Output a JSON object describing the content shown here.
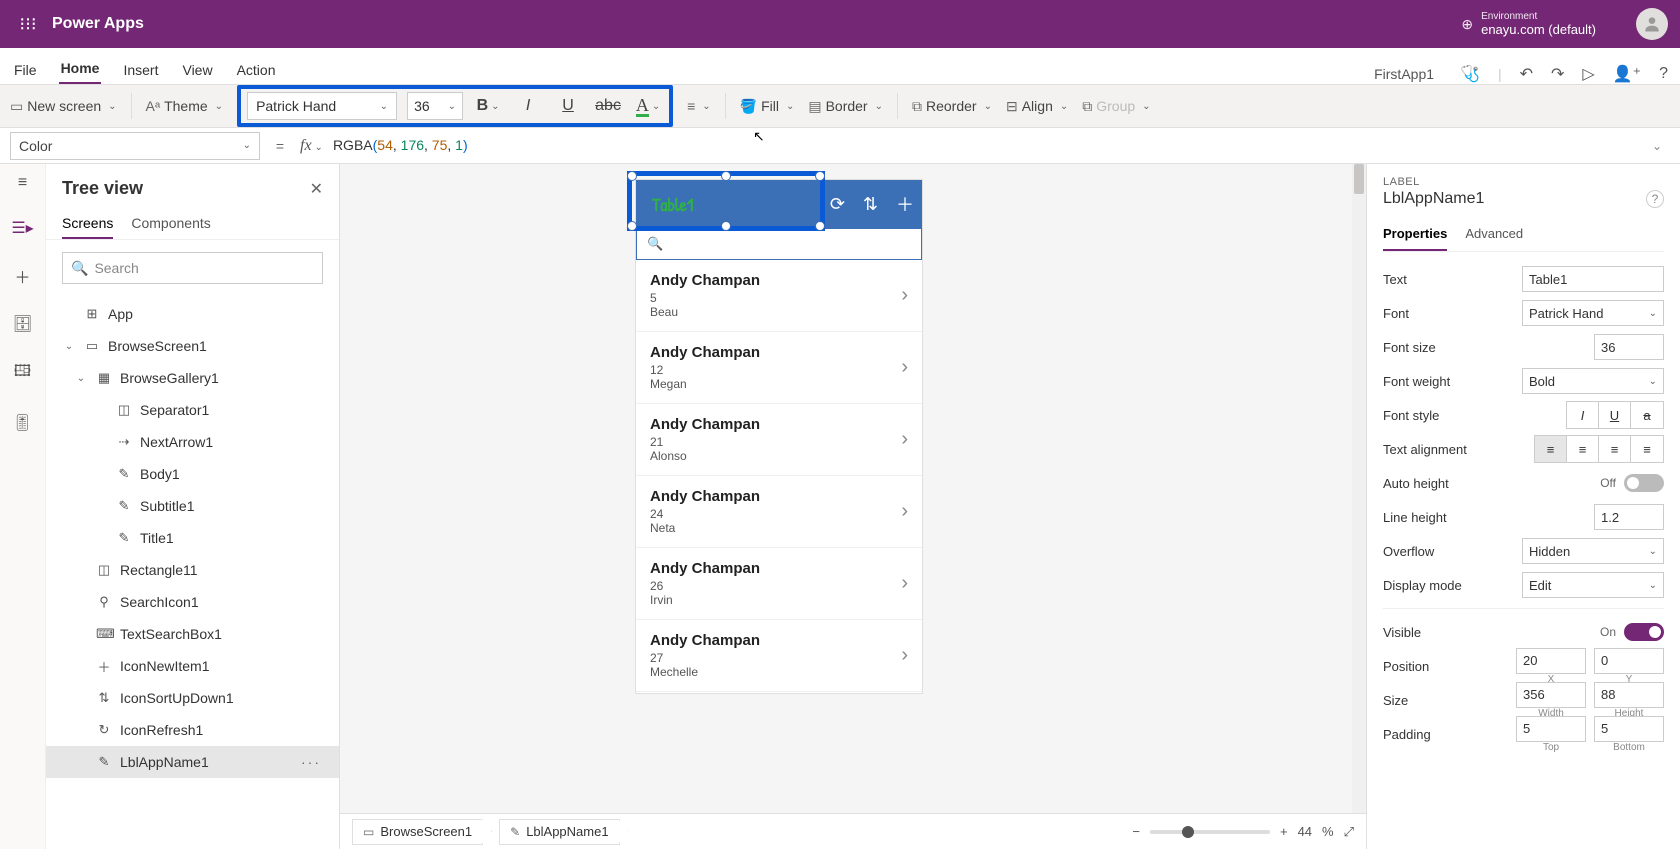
{
  "header": {
    "brand": "Power Apps",
    "env_label": "Environment",
    "env_name": "enayu.com (default)"
  },
  "menubar": {
    "items": [
      "File",
      "Home",
      "Insert",
      "View",
      "Action"
    ],
    "active": "Home",
    "app_name": "FirstApp1"
  },
  "ribbon": {
    "new_screen": "New screen",
    "theme": "Theme",
    "font_name": "Patrick Hand",
    "font_size": "36",
    "fill": "Fill",
    "border": "Border",
    "reorder": "Reorder",
    "align": "Align",
    "group": "Group"
  },
  "formula": {
    "property": "Color",
    "fn": "RGBA",
    "args": [
      "54",
      "176",
      "75",
      "1"
    ]
  },
  "tree": {
    "title": "Tree view",
    "tabs": [
      "Screens",
      "Components"
    ],
    "active_tab": "Screens",
    "search_placeholder": "Search",
    "nodes": [
      {
        "label": "App",
        "icon": "⊞",
        "indent": 0,
        "exp": ""
      },
      {
        "label": "BrowseScreen1",
        "icon": "▭",
        "indent": 0,
        "exp": "⌄"
      },
      {
        "label": "BrowseGallery1",
        "icon": "▦",
        "indent": 1,
        "exp": "⌄"
      },
      {
        "label": "Separator1",
        "icon": "◫",
        "indent": 2,
        "exp": ""
      },
      {
        "label": "NextArrow1",
        "icon": "⇢",
        "indent": 2,
        "exp": ""
      },
      {
        "label": "Body1",
        "icon": "✎",
        "indent": 2,
        "exp": ""
      },
      {
        "label": "Subtitle1",
        "icon": "✎",
        "indent": 2,
        "exp": ""
      },
      {
        "label": "Title1",
        "icon": "✎",
        "indent": 2,
        "exp": ""
      },
      {
        "label": "Rectangle11",
        "icon": "◫",
        "indent": 1,
        "exp": ""
      },
      {
        "label": "SearchIcon1",
        "icon": "⚲",
        "indent": 1,
        "exp": ""
      },
      {
        "label": "TextSearchBox1",
        "icon": "⌨",
        "indent": 1,
        "exp": ""
      },
      {
        "label": "IconNewItem1",
        "icon": "＋",
        "indent": 1,
        "exp": ""
      },
      {
        "label": "IconSortUpDown1",
        "icon": "⇅",
        "indent": 1,
        "exp": ""
      },
      {
        "label": "IconRefresh1",
        "icon": "↻",
        "indent": 1,
        "exp": ""
      },
      {
        "label": "LblAppName1",
        "icon": "✎",
        "indent": 1,
        "exp": "",
        "selected": true,
        "dots": true
      }
    ]
  },
  "canvas": {
    "title_text": "Table1",
    "gallery": [
      {
        "t1": "Andy Champan",
        "t2": "5",
        "t3": "Beau"
      },
      {
        "t1": "Andy Champan",
        "t2": "12",
        "t3": "Megan"
      },
      {
        "t1": "Andy Champan",
        "t2": "21",
        "t3": "Alonso"
      },
      {
        "t1": "Andy Champan",
        "t2": "24",
        "t3": "Neta"
      },
      {
        "t1": "Andy Champan",
        "t2": "26",
        "t3": "Irvin"
      },
      {
        "t1": "Andy Champan",
        "t2": "27",
        "t3": "Mechelle"
      }
    ],
    "breadcrumb": [
      "BrowseScreen1",
      "LblAppName1"
    ],
    "zoom_pct": "44",
    "zoom_unit": "%"
  },
  "props": {
    "type_label": "LABEL",
    "name": "LblAppName1",
    "tabs": [
      "Properties",
      "Advanced"
    ],
    "active_tab": "Properties",
    "rows": {
      "text_lab": "Text",
      "text_val": "Table1",
      "font_lab": "Font",
      "font_val": "Patrick Hand",
      "size_lab": "Font size",
      "size_val": "36",
      "weight_lab": "Font weight",
      "weight_val": "Bold",
      "style_lab": "Font style",
      "align_lab": "Text alignment",
      "autoh_lab": "Auto height",
      "autoh_val": "Off",
      "lineh_lab": "Line height",
      "lineh_val": "1.2",
      "overflow_lab": "Overflow",
      "overflow_val": "Hidden",
      "disp_lab": "Display mode",
      "disp_val": "Edit",
      "vis_lab": "Visible",
      "vis_val": "On",
      "pos_lab": "Position",
      "pos_x": "20",
      "pos_y": "0",
      "pos_xl": "X",
      "pos_yl": "Y",
      "sz_lab": "Size",
      "sz_w": "356",
      "sz_h": "88",
      "sz_wl": "Width",
      "sz_hl": "Height",
      "pad_lab": "Padding",
      "pad_t": "5",
      "pad_b": "5",
      "pad_tl": "Top",
      "pad_bl": "Bottom"
    }
  }
}
